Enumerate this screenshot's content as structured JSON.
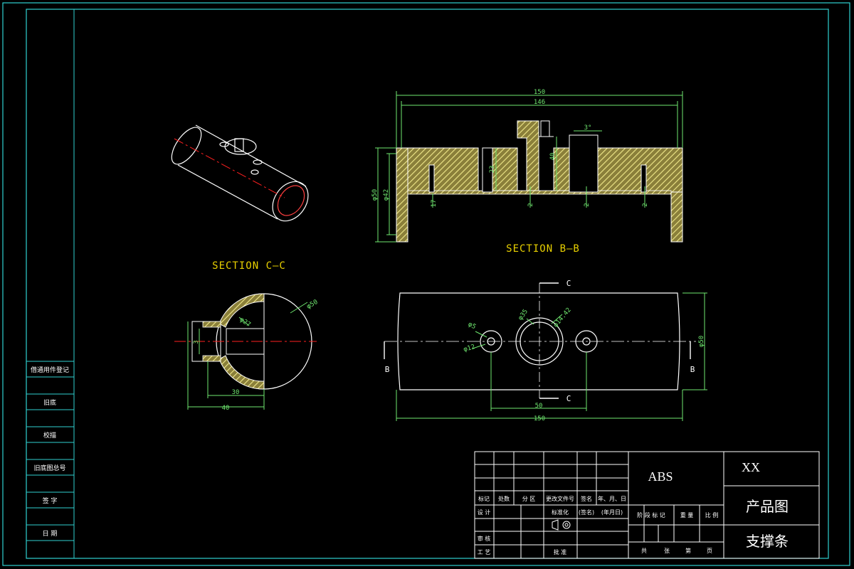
{
  "sections": {
    "c_c": "SECTION C—C",
    "b_b": "SECTION B—B"
  },
  "dimensions": {
    "top_150": "150",
    "top_146": "146",
    "angle_3": "3°",
    "d50_left": "φ50",
    "d42_left": "φ42",
    "d23": "23",
    "d40": "40",
    "d17": "17",
    "d2_a": "2",
    "d2_b": "2",
    "d2_c": "2",
    "cc_d30": "30",
    "cc_d40": "40",
    "cc_phi50": "φ50",
    "cc_phi2": "φ27",
    "cc_3": "3",
    "bot_phi12": "φ12",
    "bot_phi5": "φ5",
    "bot_phi35": "φ35",
    "bot_phi142": "φ14.42",
    "bot_50": "50",
    "bot_150": "150",
    "bot_phi50_right": "φ50",
    "cut_c_top": "C",
    "cut_c_bot": "C",
    "cut_b_left": "B",
    "cut_b_right": "B"
  },
  "left_table": [
    "借通用件登记",
    "旧底",
    "校描",
    "旧底图总号",
    "签  字",
    "日  期"
  ],
  "title_block": {
    "material": "ABS",
    "company": "XX",
    "drawing_type": "产品图",
    "part_name": "支撑条",
    "row_headers": [
      "标记",
      "处数",
      "分 区",
      "更改文件号",
      "签名",
      "年、月、日"
    ],
    "design": "设 计",
    "standardize": "标准化",
    "sign_paren": "(签名)",
    "date_paren": "(年月日)",
    "stage_headers": [
      "阶 段 标 记",
      "重 量",
      "比 例"
    ],
    "review": "审 核",
    "process": "工 艺",
    "approve": "批 准",
    "sheet_info": [
      "共",
      "张",
      "第",
      "页"
    ]
  },
  "colors": {
    "frame": "#2fd0d0",
    "outline": "#ffffff",
    "dimension": "#6fe76f",
    "hatch": "#e8e08a",
    "centerline": "#ff2020",
    "section_text": "#e8d000"
  }
}
